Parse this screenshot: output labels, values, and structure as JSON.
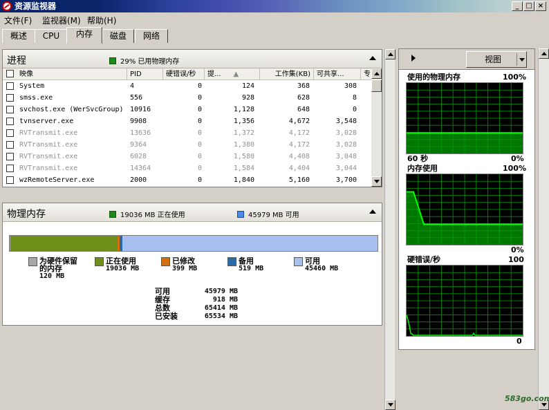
{
  "window": {
    "title": "资源监视器"
  },
  "menu": [
    "文件(F)",
    "监视器(M)",
    "帮助(H)"
  ],
  "tabs": [
    "概述",
    "CPU",
    "内存",
    "磁盘",
    "网络"
  ],
  "process": {
    "title": "进程",
    "summary": "29% 已用物理内存",
    "columns": [
      "映像",
      "PID",
      "硬错误/秒",
      "提...",
      "工作集(KB)",
      "可共享...",
      "专"
    ],
    "rows": [
      {
        "name": "System",
        "pid": "4",
        "hard": "0",
        "commit": "124",
        "ws": "368",
        "share": "308",
        "grey": false
      },
      {
        "name": "smss.exe",
        "pid": "556",
        "hard": "0",
        "commit": "928",
        "ws": "628",
        "share": "8",
        "grey": false
      },
      {
        "name": "svchost.exe (WerSvcGroup)",
        "pid": "10916",
        "hard": "0",
        "commit": "1,128",
        "ws": "648",
        "share": "0",
        "grey": false
      },
      {
        "name": "tvnserver.exe",
        "pid": "9908",
        "hard": "0",
        "commit": "1,356",
        "ws": "4,672",
        "share": "3,548",
        "grey": false
      },
      {
        "name": "RVTransmit.exe",
        "pid": "13636",
        "hard": "0",
        "commit": "1,372",
        "ws": "4,172",
        "share": "3,028",
        "grey": true
      },
      {
        "name": "RVTransmit.exe",
        "pid": "9364",
        "hard": "0",
        "commit": "1,380",
        "ws": "4,172",
        "share": "3,028",
        "grey": true
      },
      {
        "name": "RVTransmit.exe",
        "pid": "6028",
        "hard": "0",
        "commit": "1,580",
        "ws": "4,408",
        "share": "3,048",
        "grey": true
      },
      {
        "name": "RVTransmit.exe",
        "pid": "14364",
        "hard": "0",
        "commit": "1,584",
        "ws": "4,404",
        "share": "3,044",
        "grey": true
      },
      {
        "name": "wzRemoteServer.exe",
        "pid": "2000",
        "hard": "0",
        "commit": "1,840",
        "ws": "5,160",
        "share": "3,700",
        "grey": false
      }
    ]
  },
  "physical": {
    "title": "物理内存",
    "inuse_summary": "19036 MB 正在使用",
    "available_summary": "45979 MB 可用",
    "bar": {
      "hardware": 120,
      "inuse": 19036,
      "modified": 399,
      "standby": 519,
      "free": 45460,
      "total": 65534
    },
    "legend": [
      {
        "label": "为硬件保留",
        "label2": "的内存",
        "value": "120 MB",
        "color": "#a8a8a8"
      },
      {
        "label": "正在使用",
        "label2": "",
        "value": "19036 MB",
        "color": "#6f8f1a"
      },
      {
        "label": "已修改",
        "label2": "",
        "value": "399 MB",
        "color": "#d07010"
      },
      {
        "label": "备用",
        "label2": "",
        "value": "519 MB",
        "color": "#2a6aa8"
      },
      {
        "label": "可用",
        "label2": "",
        "value": "45460 MB",
        "color": "#a7c0f0"
      }
    ],
    "stats": [
      {
        "label": "可用",
        "value": "45979 MB"
      },
      {
        "label": "缓存",
        "value": "918 MB"
      },
      {
        "label": "总数",
        "value": "65414 MB"
      },
      {
        "label": "已安装",
        "value": "65534 MB"
      }
    ]
  },
  "right": {
    "view_label": "视图",
    "graphs": [
      {
        "title": "使用的物理内存",
        "max": "100%",
        "min": "0%",
        "time": "60 秒",
        "fill_fraction": 0.29
      },
      {
        "title": "内存使用",
        "max": "100%",
        "min": "0%",
        "time": "",
        "fill_start_fraction": 0.75,
        "fill_end_fraction": 0.29
      },
      {
        "title": "硬错误/秒",
        "max": "100",
        "min": "0",
        "time": ""
      }
    ]
  },
  "watermark": "583go.com",
  "colors": {
    "graph_line": "#00ff00",
    "graph_grid": "#008000",
    "graph_fill": "#00a000"
  }
}
